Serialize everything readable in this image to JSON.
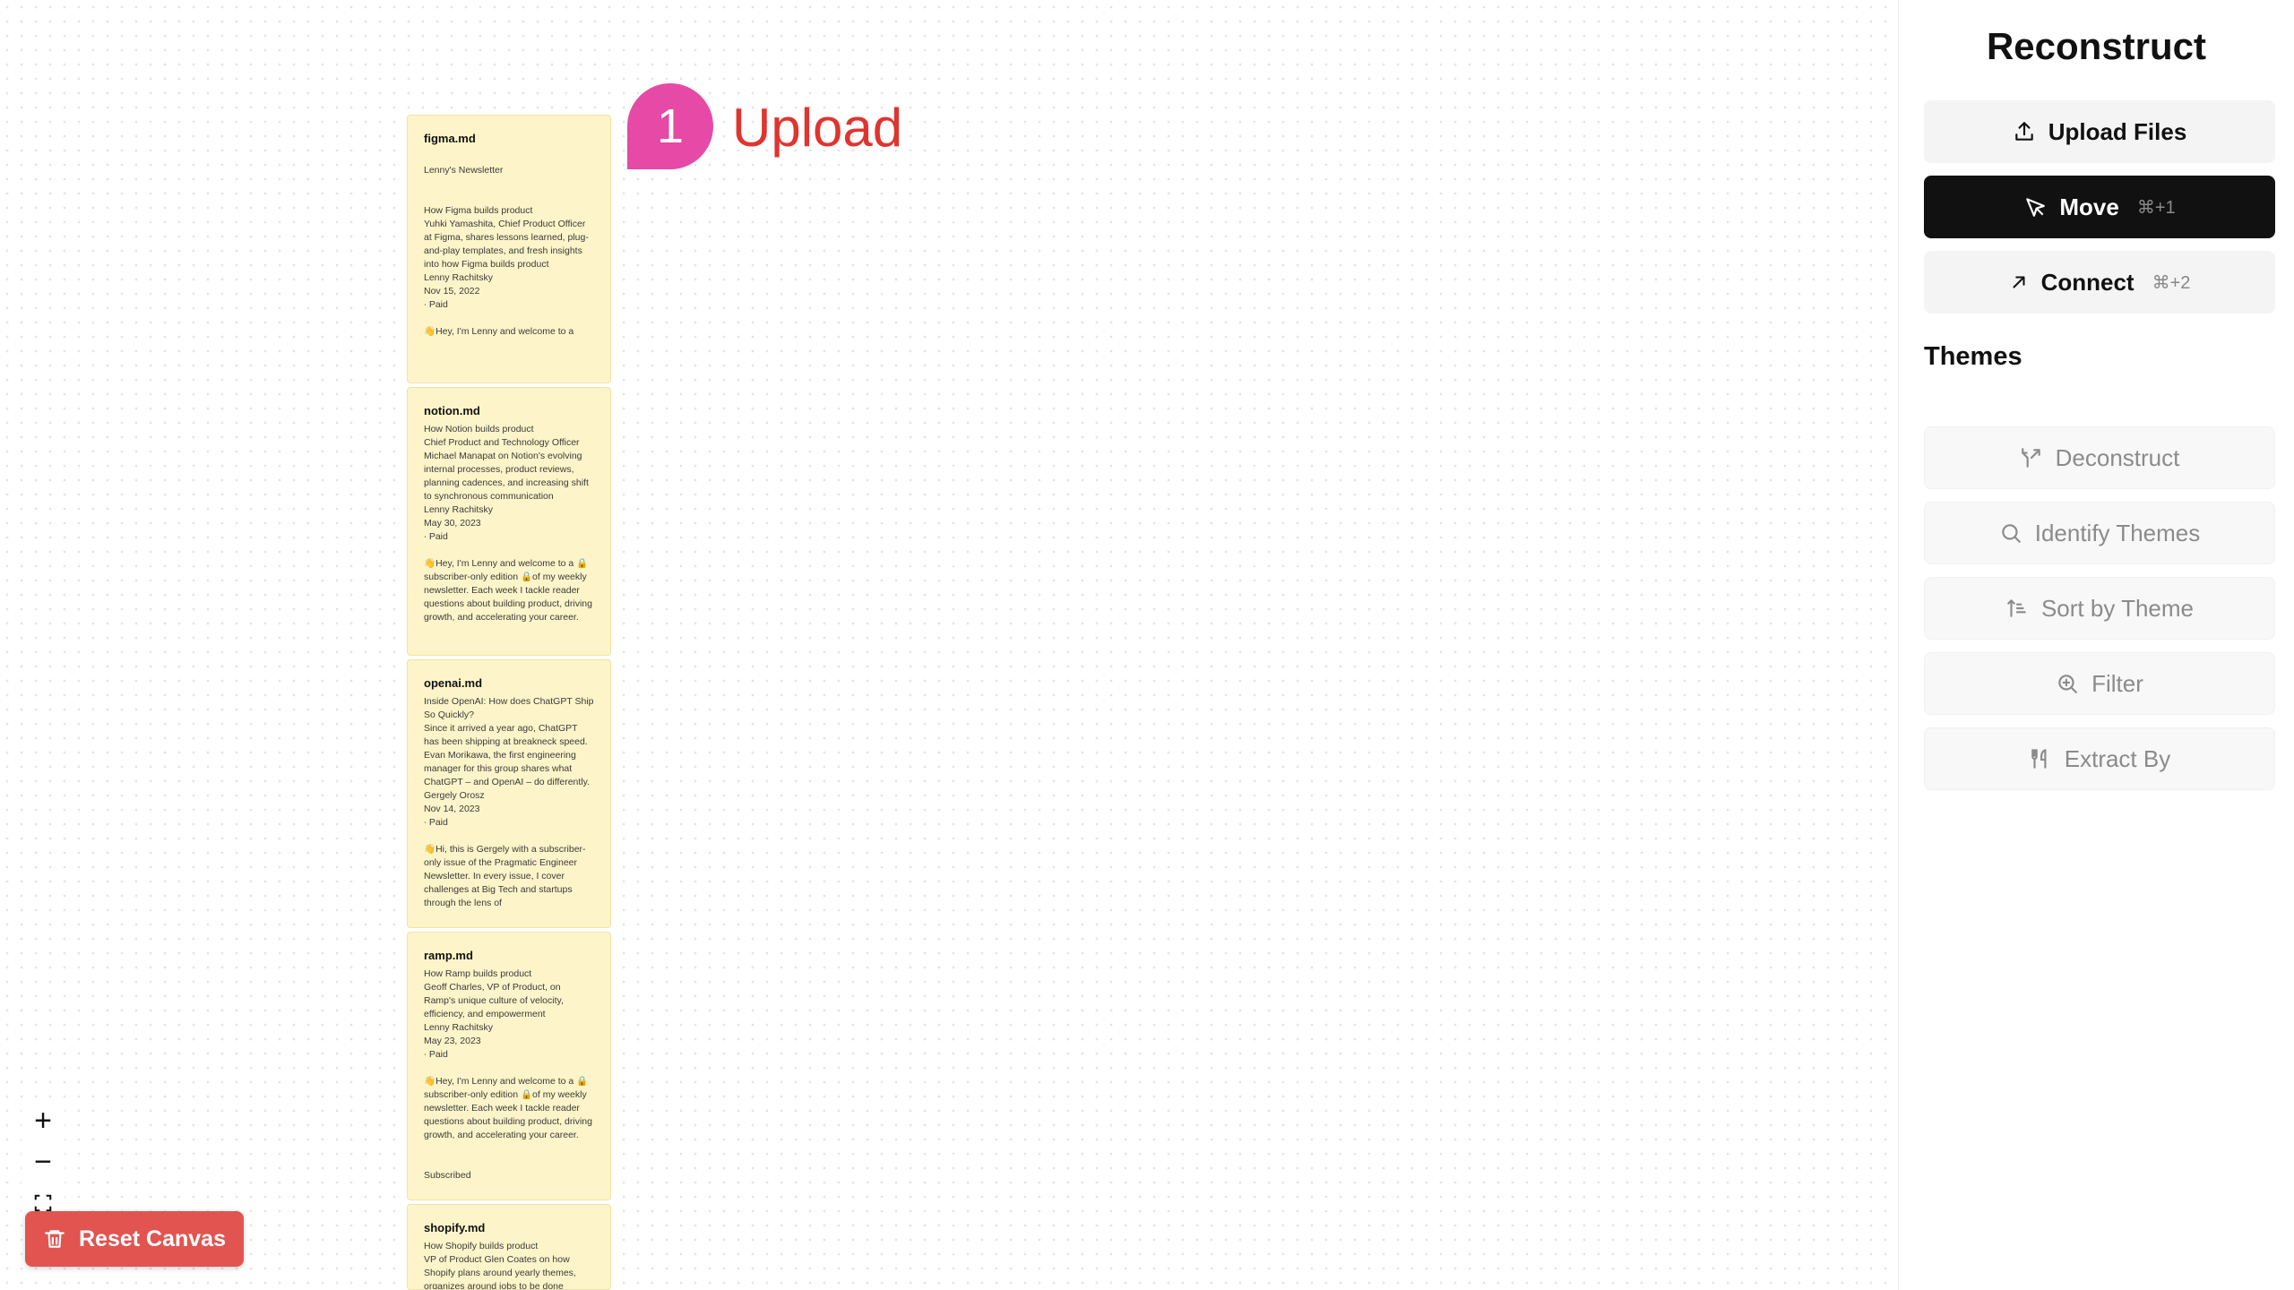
{
  "app": {
    "title": "Reconstruct"
  },
  "canvas": {
    "step": {
      "number": "1",
      "label": "Upload"
    },
    "notes": [
      {
        "title": "figma.md",
        "body": "\nLenny's Newsletter\n\n\nHow Figma builds product\nYuhki Yamashita, Chief Product Officer at Figma, shares lessons learned, plug-and-play templates, and fresh insights into how Figma builds product\nLenny Rachitsky\nNov 15, 2022\n∙ Paid\n\n👋Hey, I'm Lenny and welcome to a"
      },
      {
        "title": "notion.md",
        "body": "How Notion builds product\nChief Product and Technology Officer Michael Manapat on Notion's evolving internal processes, product reviews, planning cadences, and increasing shift to synchronous communication\nLenny Rachitsky\nMay 30, 2023\n∙ Paid\n\n👋Hey, I'm Lenny and welcome to a 🔒subscriber-only edition 🔒of my weekly newsletter. Each week I tackle reader questions about building product, driving growth, and accelerating your career."
      },
      {
        "title": "openai.md",
        "body": "Inside OpenAI: How does ChatGPT Ship So Quickly?\nSince it arrived a year ago, ChatGPT has been shipping at breakneck speed. Evan Morikawa, the first engineering manager for this group shares what ChatGPT – and OpenAI – do differently.\nGergely Orosz\nNov 14, 2023\n∙ Paid\n\n👋Hi, this is Gergely with a subscriber-only issue of the Pragmatic Engineer Newsletter. In every issue, I cover challenges at Big Tech and startups through the lens of"
      },
      {
        "title": "ramp.md",
        "body": "How Ramp builds product\nGeoff Charles, VP of Product, on Ramp's unique culture of velocity, efficiency, and empowerment\nLenny Rachitsky\nMay 23, 2023\n∙ Paid\n\n👋Hey, I'm Lenny and welcome to a 🔒subscriber-only edition 🔒of my weekly newsletter. Each week I tackle reader questions about building product, driving growth, and accelerating your career.\n\n\nSubscribed"
      },
      {
        "title": "shopify.md",
        "body": "How Shopify builds product\nVP of Product Glen Coates on how Shopify plans around yearly themes, organizes around jobs to be done"
      }
    ],
    "zoom": {
      "in_label": "+",
      "out_label": "−"
    },
    "reset": {
      "label": "Reset Canvas"
    }
  },
  "sidebar": {
    "upload": {
      "label": "Upload Files"
    },
    "move": {
      "label": "Move",
      "shortcut": "⌘+1"
    },
    "connect": {
      "label": "Connect",
      "shortcut": "⌘+2"
    },
    "themes_heading": "Themes",
    "actions": [
      {
        "label": "Deconstruct",
        "icon": "split-icon"
      },
      {
        "label": "Identify Themes",
        "icon": "search-icon"
      },
      {
        "label": "Sort by Theme",
        "icon": "sort-icon"
      },
      {
        "label": "Filter",
        "icon": "zoom-in-icon"
      },
      {
        "label": "Extract By",
        "icon": "utensils-icon"
      }
    ]
  },
  "colors": {
    "note_bg": "#fdf5c9",
    "badge": "#e64aa6",
    "step_label": "#e0342e",
    "reset_button": "#e25450",
    "active_button": "#111111"
  }
}
